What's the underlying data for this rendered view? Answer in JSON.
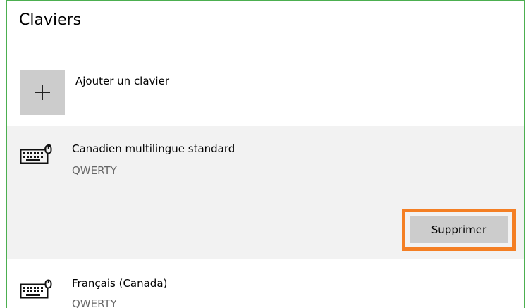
{
  "section": {
    "title": "Claviers"
  },
  "add_keyboard": {
    "label": "Ajouter un clavier",
    "icon": "plus-icon"
  },
  "keyboards": [
    {
      "name": "Canadien multilingue standard",
      "layout": "QWERTY",
      "icon": "keyboard-icon",
      "selected": true,
      "remove_label": "Supprimer"
    },
    {
      "name": "Français (Canada)",
      "layout": "QWERTY",
      "icon": "keyboard-icon",
      "selected": false
    }
  ],
  "colors": {
    "highlight_border": "#f47f24",
    "frame_border": "#4caf50",
    "selected_background": "#f2f2f2",
    "tile_background": "#cccccc"
  }
}
